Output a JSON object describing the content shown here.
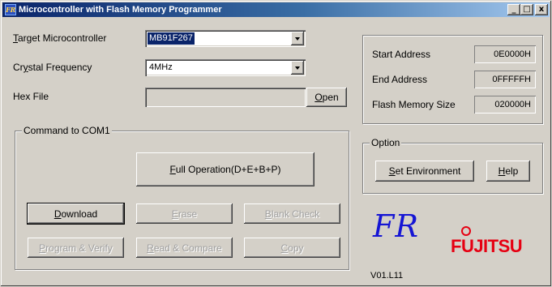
{
  "window": {
    "title": "Microcontroller with Flash Memory Programmer",
    "controls": {
      "minimize": "_",
      "maximize": "□",
      "close": "x"
    }
  },
  "form": {
    "target_label_u": "T",
    "target_label_rest": "arget Microcontroller",
    "target_value": "MB91F267",
    "crystal_label_pre": "Cr",
    "crystal_label_u": "y",
    "crystal_label_rest": "stal Frequency",
    "crystal_value": "4MHz",
    "hex_label": "Hex File",
    "hex_value": "",
    "open_button_u": "O",
    "open_button_rest": "pen"
  },
  "info": {
    "start_address_label": "Start Address",
    "start_address_value": "0E0000H",
    "end_address_label": "End Address",
    "end_address_value": "0FFFFFH",
    "flash_size_label": "Flash Memory Size",
    "flash_size_value": "020000H"
  },
  "command": {
    "group_caption": "Command to COM1",
    "full_operation_u": "F",
    "full_operation_rest": "ull Operation(D+E+B+P)",
    "download_u": "D",
    "download_rest": "ownload",
    "erase_u": "E",
    "erase_rest": "rase",
    "blank_check_u": "B",
    "blank_check_rest": "lank Check",
    "program_verify_u": "P",
    "program_verify_rest": "rogram & Verify",
    "read_compare_u": "R",
    "read_compare_rest": "ead & Compare",
    "copy_u": "C",
    "copy_rest": "opy"
  },
  "option": {
    "group_caption": "Option",
    "set_env_u": "S",
    "set_env_rest": "et Environment",
    "help_u": "H",
    "help_rest": "elp"
  },
  "branding": {
    "fr_logo": "FR",
    "fujitsu_logo": "FUJITSU",
    "version": "V01.L11",
    "fr_color": "#1515d4",
    "fujitsu_color": "#e60012"
  }
}
